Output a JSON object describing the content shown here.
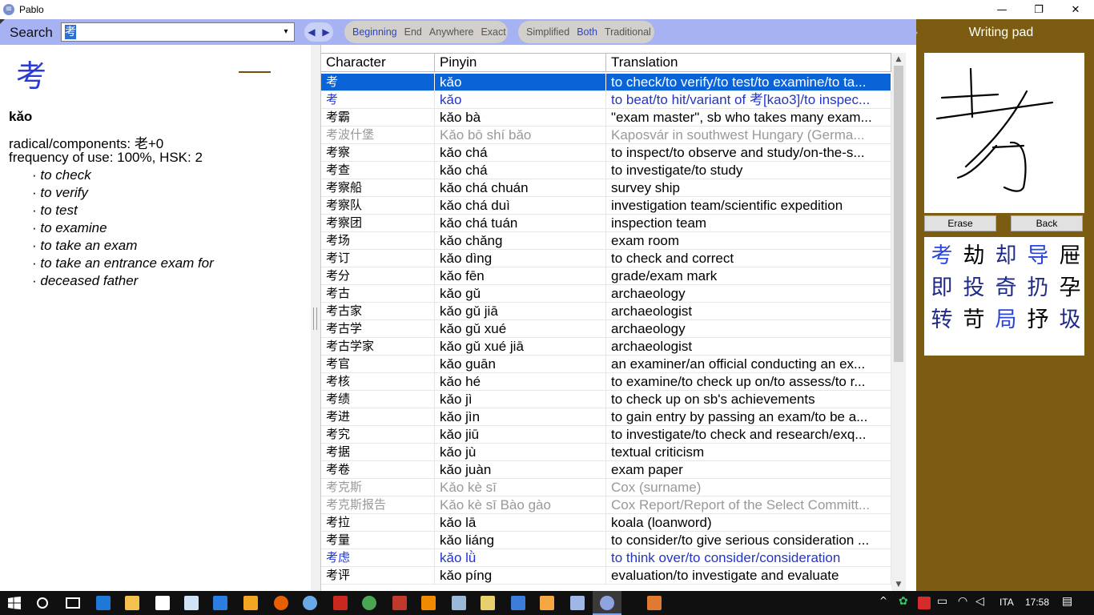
{
  "window": {
    "title": "Pablo",
    "app_icon": "pablo-icon",
    "controls": {
      "minimize": "—",
      "maximize": "❐",
      "close": "✕"
    }
  },
  "search": {
    "label": "Search",
    "value": "考",
    "dropdown_glyph": "▾",
    "nav_prev": "◀",
    "nav_next": "▶",
    "match_modes": [
      "Beginning",
      "End",
      "Anywhere",
      "Exact"
    ],
    "match_active": "Beginning",
    "script_modes": [
      "Simplified",
      "Both",
      "Traditional"
    ],
    "script_active": "Both"
  },
  "detail": {
    "character": "考",
    "pinyin": "kǎo",
    "radical_line": "radical/components: 老+0",
    "frequency_line": "frequency of use: 100%, HSK: 2",
    "definitions": [
      "to check",
      "to verify",
      "to test",
      "to examine",
      "to take an exam",
      "to take an entrance exam for",
      "deceased father"
    ]
  },
  "table": {
    "headers": {
      "character": "Character",
      "pinyin": "Pinyin",
      "translation": "Translation"
    },
    "rows": [
      {
        "character": "考",
        "pinyin": "kǎo",
        "translation": "to check/to verify/to test/to examine/to ta...",
        "style": "selected"
      },
      {
        "character": "考",
        "pinyin": "kǎo",
        "translation": "to beat/to hit/variant of 考[kao3]/to inspec...",
        "style": "variant"
      },
      {
        "character": "考霸",
        "pinyin": "kǎo bà",
        "translation": "\"exam master\", sb who takes many exam...",
        "style": "normal"
      },
      {
        "character": "考波什堡",
        "pinyin": "Kǎo bō shí bǎo",
        "translation": "Kaposvár in southwest Hungary (Germa...",
        "style": "grey"
      },
      {
        "character": "考察",
        "pinyin": "kǎo chá",
        "translation": "to inspect/to observe and study/on-the-s...",
        "style": "normal"
      },
      {
        "character": "考查",
        "pinyin": "kǎo chá",
        "translation": "to investigate/to study",
        "style": "normal"
      },
      {
        "character": "考察船",
        "pinyin": "kǎo chá chuán",
        "translation": "survey ship",
        "style": "normal"
      },
      {
        "character": "考察队",
        "pinyin": "kǎo chá duì",
        "translation": "investigation team/scientific expedition",
        "style": "normal"
      },
      {
        "character": "考察团",
        "pinyin": "kǎo chá tuán",
        "translation": "inspection team",
        "style": "normal"
      },
      {
        "character": "考场",
        "pinyin": "kǎo chǎng",
        "translation": "exam room",
        "style": "normal"
      },
      {
        "character": "考订",
        "pinyin": "kǎo dìng",
        "translation": "to check and correct",
        "style": "normal"
      },
      {
        "character": "考分",
        "pinyin": "kǎo fēn",
        "translation": "grade/exam mark",
        "style": "normal"
      },
      {
        "character": "考古",
        "pinyin": "kǎo gǔ",
        "translation": "archaeology",
        "style": "normal"
      },
      {
        "character": "考古家",
        "pinyin": "kǎo gǔ jiā",
        "translation": "archaeologist",
        "style": "normal"
      },
      {
        "character": "考古学",
        "pinyin": "kǎo gǔ xué",
        "translation": "archaeology",
        "style": "normal"
      },
      {
        "character": "考古学家",
        "pinyin": "kǎo gǔ xué jiā",
        "translation": "archaeologist",
        "style": "normal"
      },
      {
        "character": "考官",
        "pinyin": "kǎo guān",
        "translation": "an examiner/an official conducting an ex...",
        "style": "normal"
      },
      {
        "character": "考核",
        "pinyin": "kǎo hé",
        "translation": "to examine/to check up on/to assess/to r...",
        "style": "normal"
      },
      {
        "character": "考绩",
        "pinyin": "kǎo jì",
        "translation": "to check up on sb's achievements",
        "style": "normal"
      },
      {
        "character": "考进",
        "pinyin": "kǎo jìn",
        "translation": "to gain entry by passing an exam/to be a...",
        "style": "normal"
      },
      {
        "character": "考究",
        "pinyin": "kǎo jiū",
        "translation": "to investigate/to check and research/exq...",
        "style": "normal"
      },
      {
        "character": "考据",
        "pinyin": "kǎo jù",
        "translation": "textual criticism",
        "style": "normal"
      },
      {
        "character": "考卷",
        "pinyin": "kǎo juàn",
        "translation": "exam paper",
        "style": "normal"
      },
      {
        "character": "考克斯",
        "pinyin": "Kǎo kè sī",
        "translation": "Cox (surname)",
        "style": "grey"
      },
      {
        "character": "考克斯报告",
        "pinyin": "Kǎo kè sī Bào gào",
        "translation": "Cox Report/Report of the Select Committ...",
        "style": "grey"
      },
      {
        "character": "考拉",
        "pinyin": "kǎo lā",
        "translation": "koala (loanword)",
        "style": "normal"
      },
      {
        "character": "考量",
        "pinyin": "kǎo liáng",
        "translation": "to consider/to give serious consideration ...",
        "style": "normal"
      },
      {
        "character": "考虑",
        "pinyin": "kǎo lǜ",
        "translation": "to think over/to consider/consideration",
        "style": "variant"
      },
      {
        "character": "考评",
        "pinyin": "kǎo píng",
        "translation": "evaluation/to investigate and evaluate",
        "style": "normal"
      }
    ]
  },
  "writing_pad": {
    "title": "Writing pad",
    "erase_label": "Erase",
    "back_label": "Back",
    "candidates": [
      {
        "char": "考",
        "tone": "blue"
      },
      {
        "char": "劫",
        "tone": "black"
      },
      {
        "char": "却",
        "tone": "navy"
      },
      {
        "char": "导",
        "tone": "blue"
      },
      {
        "char": "屉",
        "tone": "black"
      },
      {
        "char": "即",
        "tone": "navy"
      },
      {
        "char": "投",
        "tone": "navy"
      },
      {
        "char": "奇",
        "tone": "navy"
      },
      {
        "char": "扔",
        "tone": "navy"
      },
      {
        "char": "孕",
        "tone": "black"
      },
      {
        "char": "转",
        "tone": "navy"
      },
      {
        "char": "苛",
        "tone": "black"
      },
      {
        "char": "局",
        "tone": "blue"
      },
      {
        "char": "抒",
        "tone": "black"
      },
      {
        "char": "圾",
        "tone": "navy"
      }
    ]
  },
  "taskbar": {
    "language": "ITA",
    "time": "17:58"
  },
  "colors": {
    "search_bar": "#a7b2f3",
    "writing_panel": "#7c5c10",
    "selection": "#0a64d8",
    "variant_text": "#2235c8"
  }
}
